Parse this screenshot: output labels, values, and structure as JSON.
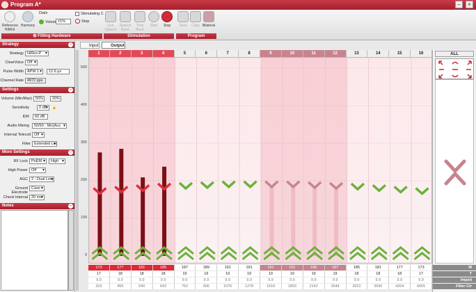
{
  "window": {
    "title": "Program A*"
  },
  "ribbon": {
    "reference_label": "Reference",
    "reference_sub": "HiRKit",
    "harmony_label": "Harmony",
    "dials_label": "Dials",
    "volume_label": "Volume:",
    "volume_value": "±1%",
    "stimulating_label": "Stimulating C",
    "stop_small_label": "Stop",
    "fitting_hardware_label": "Fitting Hardware",
    "live_speech": "Live Speech",
    "speech_burst": "Speech Burst",
    "tone_burst": "Tone Burst",
    "start_label": "Start",
    "stop_label": "Stop",
    "stimulation_label": "Stimulation",
    "save_label": "Save",
    "copy_label": "Copy",
    "bilateral_label": "Bilateral",
    "program_label": "Program"
  },
  "strategy": {
    "header": "Strategy",
    "strategy_label": "Strategy",
    "strategy_value": "HiRes-P",
    "clearvoice_label": "ClearVoice",
    "clearvoice_value": "Off",
    "pulse_width_label": "Pulse Width",
    "pulse_width_value": "APW 1",
    "pulse_width_us": "12.6 μs",
    "channel_rate_label": "Channel Rate",
    "channel_rate_value": "4972 pps"
  },
  "settings": {
    "header": "Settings",
    "volume_label": "Volume (Min/Max)",
    "volume_min": "50%",
    "volume_max": "20%",
    "sensitivity_label": "Sensitivity",
    "sensitivity_value": "0 dB",
    "idr_label": "IDR",
    "idr_value": "60 dB",
    "audio_mixing_label": "Audio Mixing",
    "audio_mixing_value": "50/50 - Mic|Aux",
    "telecoil_label": "Internal Telecoil",
    "telecoil_value": "Off",
    "filter_label": "Filter",
    "filter_value": "Extended Low"
  },
  "more_settings": {
    "header": "More Settings",
    "rf_lock_label": "RF Lock",
    "rf_lock_value": "PoEM",
    "rf_lock_level": "High",
    "high_power_label": "High Power",
    "high_power_value": "Off",
    "agc_label": "AGC",
    "agc_value": "2 - Dual Loop",
    "ground_label": "Ground Electrode",
    "ground_value": "Case",
    "check_interval_label": "Check Interval",
    "check_interval_value": "20 ms"
  },
  "notes": {
    "header": "Notes"
  },
  "tabs": {
    "input": "Input",
    "output": "Output"
  },
  "all_label": "ALL",
  "yaxis": [
    "500",
    "400",
    "300",
    "200",
    "100",
    "0"
  ],
  "right_labels": {
    "m": "M",
    "t": "T",
    "imped": "Imped",
    "filter": "Filter Ctr"
  },
  "channels": [
    {
      "n": "1",
      "sel": true,
      "m": "173",
      "t": "17",
      "imp": "9.9",
      "fc": "333",
      "level": 0.29,
      "dark": true
    },
    {
      "n": "2",
      "sel": true,
      "m": "177",
      "t": "18",
      "imp": "9.9",
      "fc": "455",
      "level": 0.3,
      "dark": true
    },
    {
      "n": "3",
      "sel": true,
      "m": "181",
      "t": "18",
      "imp": "9.9",
      "fc": "540",
      "level": 0.22,
      "dark": true
    },
    {
      "n": "4",
      "sel": true,
      "m": "185",
      "t": "18",
      "imp": "9.9",
      "fc": "642",
      "level": 0.25,
      "dark": true
    },
    {
      "n": "5",
      "sel": false,
      "m": "187",
      "t": "19",
      "imp": "9.9",
      "fc": "762",
      "level": 0,
      "dark": false
    },
    {
      "n": "6",
      "sel": false,
      "m": "189",
      "t": "19",
      "imp": "9.9",
      "fc": "906",
      "level": 0,
      "dark": false
    },
    {
      "n": "7",
      "sel": false,
      "m": "191",
      "t": "19",
      "imp": "9.9",
      "fc": "1076",
      "level": 0,
      "dark": false
    },
    {
      "n": "8",
      "sel": false,
      "m": "191",
      "t": "19",
      "imp": "9.9",
      "fc": "1278",
      "level": 0,
      "dark": false
    },
    {
      "n": "9",
      "sel": true,
      "m": "191",
      "t": "19",
      "imp": "9.9",
      "fc": "1518",
      "level": 0,
      "dark": false
    },
    {
      "n": "10",
      "sel": true,
      "m": "191",
      "t": "19",
      "imp": "9.9",
      "fc": "1803",
      "level": 0,
      "dark": false
    },
    {
      "n": "11",
      "sel": true,
      "m": "189",
      "t": "19",
      "imp": "9.9",
      "fc": "2142",
      "level": 0,
      "dark": false
    },
    {
      "n": "12",
      "sel": true,
      "m": "187",
      "t": "19",
      "imp": "9.9",
      "fc": "2544",
      "level": 0,
      "dark": false
    },
    {
      "n": "13",
      "sel": false,
      "m": "185",
      "t": "18",
      "imp": "9.9",
      "fc": "3022",
      "level": 0,
      "dark": false
    },
    {
      "n": "14",
      "sel": false,
      "m": "181",
      "t": "18",
      "imp": "9.9",
      "fc": "3590",
      "level": 0,
      "dark": false
    },
    {
      "n": "15",
      "sel": false,
      "m": "177",
      "t": "18",
      "imp": "9.9",
      "fc": "4264",
      "level": 0,
      "dark": false
    },
    {
      "n": "16",
      "sel": false,
      "m": "173",
      "t": "17",
      "imp": "9.9",
      "fc": "6665",
      "level": 0,
      "dark": false
    }
  ],
  "colors": {
    "accent": "#b3202f",
    "selected_red": "#d93040",
    "selected_pink": "#c7848e",
    "green": "#6ab23a"
  }
}
